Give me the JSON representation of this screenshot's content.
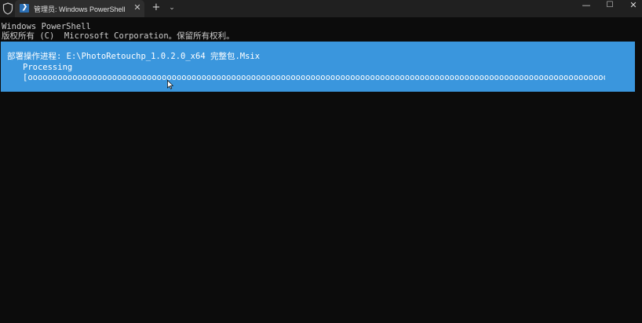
{
  "window": {
    "tab_title": "管理员: Windows PowerShell",
    "tab_icon_glyph": "❯",
    "close_tab_glyph": "✕",
    "new_tab_glyph": "+",
    "dropdown_glyph": "⌄",
    "minimize_glyph": "—",
    "maximize_glyph": "☐",
    "close_glyph": "✕",
    "titlebar_color": "#202020",
    "tab_color": "#2e2e2e"
  },
  "terminal": {
    "background": "#0c0c0c",
    "lines": [
      "Windows PowerShell",
      "版权所有 (C)  Microsoft Corporation。保留所有权利。"
    ]
  },
  "progress": {
    "color": "#3a96dd",
    "activity": "部署操作进程: E:\\PhotoRetouchp_1.0.2.0_x64 完整包.Msix",
    "status": "Processing",
    "bar": "[oooooooooooooooooooooooooooooooooooooooooooooooooooooooooooooooooooooooooooooooooooooooooooooooooooooooooooooooooooooooooooooooooooooooooooooooooooooooo]"
  }
}
